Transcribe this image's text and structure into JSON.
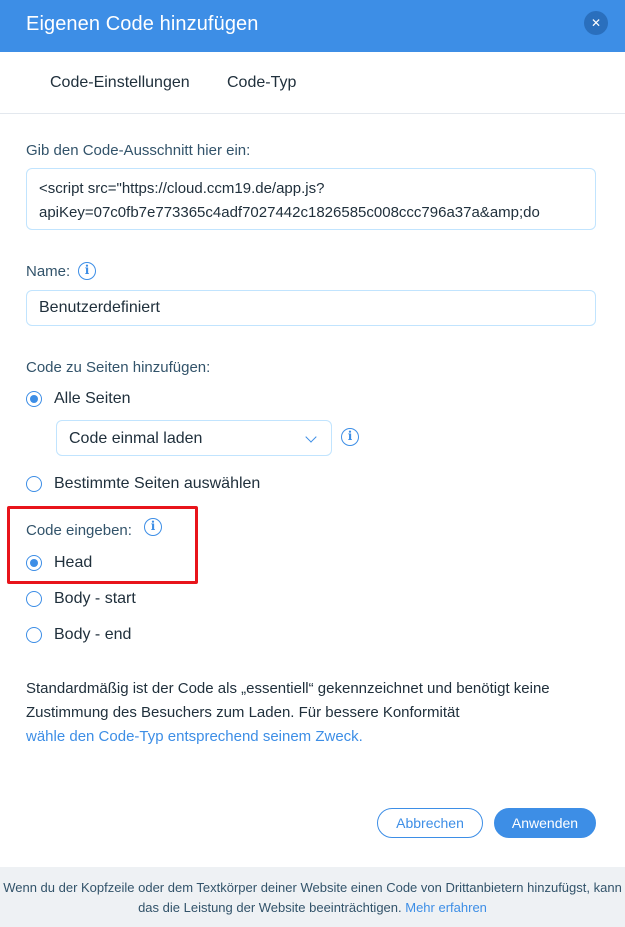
{
  "dialog": {
    "title": "Eigenen Code hinzufügen",
    "close_symbol": "✕"
  },
  "tabs": [
    {
      "label": "Code-Einstellungen"
    },
    {
      "label": "Code-Typ"
    }
  ],
  "snippet": {
    "label": "Gib den Code-Ausschnitt hier ein:",
    "value_line1": "<script src=\"https://cloud.ccm19.de/app.js?",
    "value_line2": "apiKey=07c0fb7e773365c4adf7027442c1826585c008ccc796a37a&amp;do"
  },
  "name": {
    "label": "Name:",
    "value": "Benutzerdefiniert"
  },
  "pages": {
    "label": "Code zu Seiten hinzufügen:",
    "all_pages": "Alle Seiten",
    "load_select": "Code einmal laden",
    "specific_pages": "Bestimmte Seiten auswählen",
    "selected": "all_pages"
  },
  "placement": {
    "label": "Code eingeben:",
    "head": "Head",
    "body_start": "Body - start",
    "body_end": "Body - end",
    "selected": "head"
  },
  "info": {
    "text": "Standardmäßig ist der Code als „essentiell“ gekennzeichnet und benötigt keine Zustimmung des Besuchers zum Laden. Für bessere Konformität",
    "link": "wähle den Code-Typ entsprechend seinem Zweck."
  },
  "buttons": {
    "cancel": "Abbrechen",
    "apply": "Anwenden"
  },
  "footer": {
    "text": "Wenn du der Kopfzeile oder dem Textkörper deiner Website einen Code von Drittanbietern hinzufügst, kann das die Leistung der Website beeinträchtigen.",
    "link": "Mehr erfahren"
  },
  "colors": {
    "accent": "#3d8ee6",
    "highlight": "#e8141b",
    "footer_bg": "#eef1f4"
  },
  "icons": {
    "close": "close-icon",
    "info": "info-icon",
    "chevron": "chevron-down-icon"
  }
}
